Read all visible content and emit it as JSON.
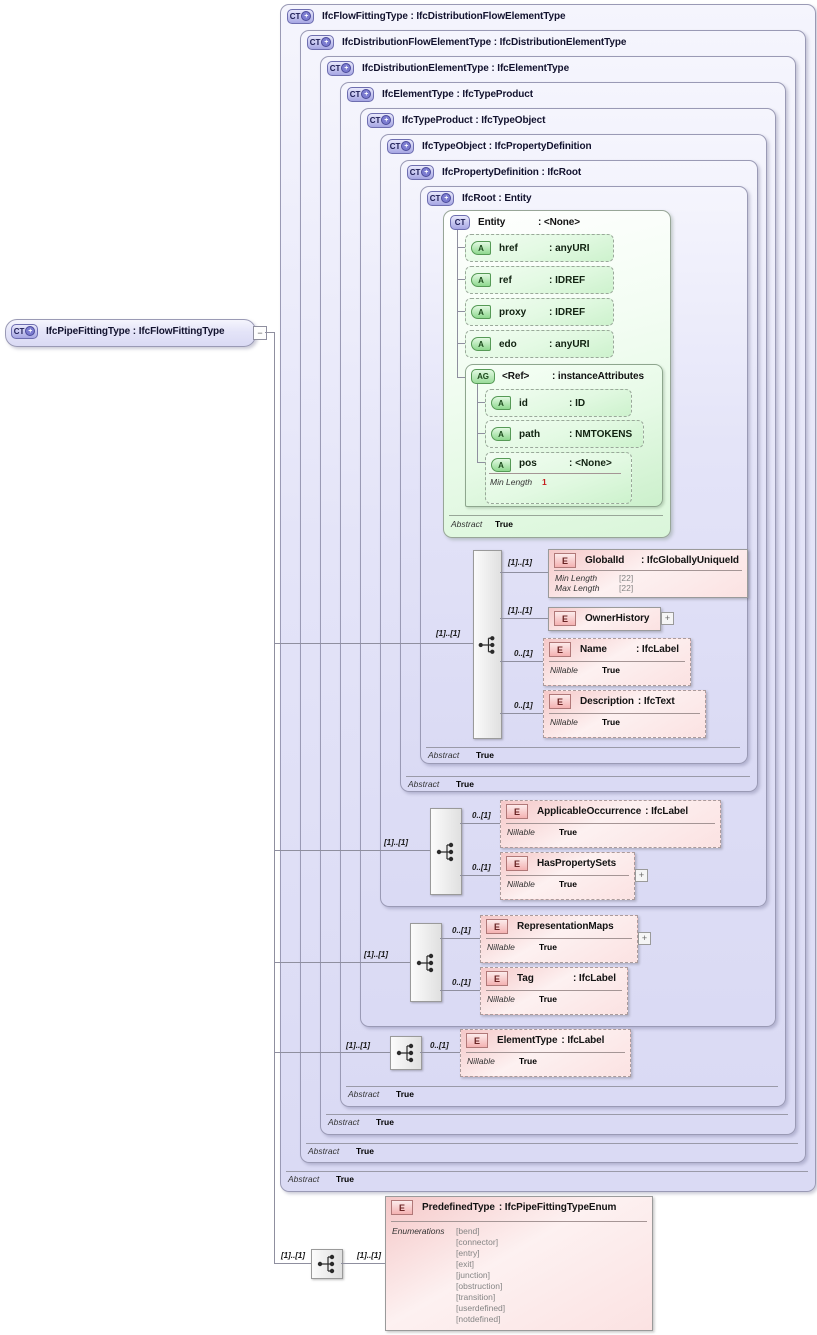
{
  "icons": {
    "plus": "+",
    "minus": "−"
  },
  "main_box": {
    "badge": "CT",
    "label": "IfcPipeFittingType : IfcFlowFittingType"
  },
  "levels": [
    {
      "badge": "CT",
      "label": "IfcFlowFittingType : IfcDistributionFlowElementType",
      "abstract_label": "Abstract",
      "abstract_value": "True"
    },
    {
      "badge": "CT",
      "label": "IfcDistributionFlowElementType : IfcDistributionElementType",
      "abstract_label": "Abstract",
      "abstract_value": "True"
    },
    {
      "badge": "CT",
      "label": "IfcDistributionElementType : IfcElementType",
      "abstract_label": "Abstract",
      "abstract_value": "True"
    },
    {
      "badge": "CT",
      "label": "IfcElementType : IfcTypeProduct",
      "abstract_label": "Abstract",
      "abstract_value": "True"
    },
    {
      "badge": "CT",
      "label": "IfcTypeProduct : IfcTypeObject"
    },
    {
      "badge": "CT",
      "label": "IfcTypeObject : IfcPropertyDefinition"
    },
    {
      "badge": "CT",
      "label": "IfcPropertyDefinition : IfcRoot",
      "abstract_label": "Abstract",
      "abstract_value": "True"
    },
    {
      "badge": "CT",
      "label": "IfcRoot : Entity",
      "abstract_label": "Abstract",
      "abstract_value": "True"
    }
  ],
  "entity": {
    "badge": "CT",
    "name": "Entity",
    "type": ": <None>",
    "attributes": [
      {
        "badge": "A",
        "name": "href",
        "type": ": anyURI"
      },
      {
        "badge": "A",
        "name": "ref",
        "type": ": IDREF"
      },
      {
        "badge": "A",
        "name": "proxy",
        "type": ": IDREF"
      },
      {
        "badge": "A",
        "name": "edo",
        "type": ": anyURI"
      }
    ],
    "ref_group": {
      "badge": "AG",
      "name": "<Ref>",
      "type": ": instanceAttributes",
      "attributes": [
        {
          "badge": "A",
          "name": "id",
          "type": ": ID"
        },
        {
          "badge": "A",
          "name": "path",
          "type": ": NMTOKENS"
        }
      ],
      "pos_attribute": {
        "badge": "A",
        "name": "pos",
        "type": ": <None>",
        "facet_label": "Min Length",
        "facet_value": "1"
      }
    },
    "abstract_label": "Abstract",
    "abstract_value": "True"
  },
  "root_sequence": {
    "cardinality": "[1]..[1]",
    "globalid": {
      "badge": "E",
      "name": "GlobalId",
      "type": ": IfcGloballyUniqueId",
      "cardinality": "[1]..[1]",
      "facets": [
        {
          "label": "Min Length",
          "value": "[22]"
        },
        {
          "label": "Max Length",
          "value": "[22]"
        }
      ]
    },
    "ownerhistory": {
      "badge": "E",
      "name": "OwnerHistory",
      "cardinality": "[1]..[1]"
    },
    "name": {
      "badge": "E",
      "name": "Name",
      "type": ": IfcLabel",
      "cardinality": "0..[1]",
      "facet_label": "Nillable",
      "facet_value": "True"
    },
    "description": {
      "badge": "E",
      "name": "Description",
      "type": ": IfcText",
      "cardinality": "0..[1]",
      "facet_label": "Nillable",
      "facet_value": "True"
    }
  },
  "typeobject_sequence": {
    "cardinality": "[1]..[1]",
    "applicableoccurrence": {
      "badge": "E",
      "name": "ApplicableOccurrence",
      "type": ": IfcLabel",
      "cardinality": "0..[1]",
      "facet_label": "Nillable",
      "facet_value": "True"
    },
    "haspropertysets": {
      "badge": "E",
      "name": "HasPropertySets",
      "cardinality": "0..[1]",
      "facet_label": "Nillable",
      "facet_value": "True"
    }
  },
  "typeproduct_sequence": {
    "cardinality": "[1]..[1]",
    "representationmaps": {
      "badge": "E",
      "name": "RepresentationMaps",
      "cardinality": "0..[1]",
      "facet_label": "Nillable",
      "facet_value": "True"
    },
    "tag": {
      "badge": "E",
      "name": "Tag",
      "type": ": IfcLabel",
      "cardinality": "0..[1]",
      "facet_label": "Nillable",
      "facet_value": "True"
    }
  },
  "elementtype_sequence": {
    "cardinality": "[1]..[1]",
    "elementtype": {
      "badge": "E",
      "name": "ElementType",
      "type": ": IfcLabel",
      "cardinality": "0..[1]",
      "facet_label": "Nillable",
      "facet_value": "True"
    }
  },
  "predefined_sequence": {
    "cardinality_left": "[1]..[1]",
    "cardinality_right": "[1]..[1]",
    "predefinedtype": {
      "badge": "E",
      "name": "PredefinedType",
      "type": ": IfcPipeFittingTypeEnum",
      "facet_label": "Enumerations",
      "values": [
        "[bend]",
        "[connector]",
        "[entry]",
        "[exit]",
        "[junction]",
        "[obstruction]",
        "[transition]",
        "[userdefined]",
        "[notdefined]"
      ]
    }
  }
}
